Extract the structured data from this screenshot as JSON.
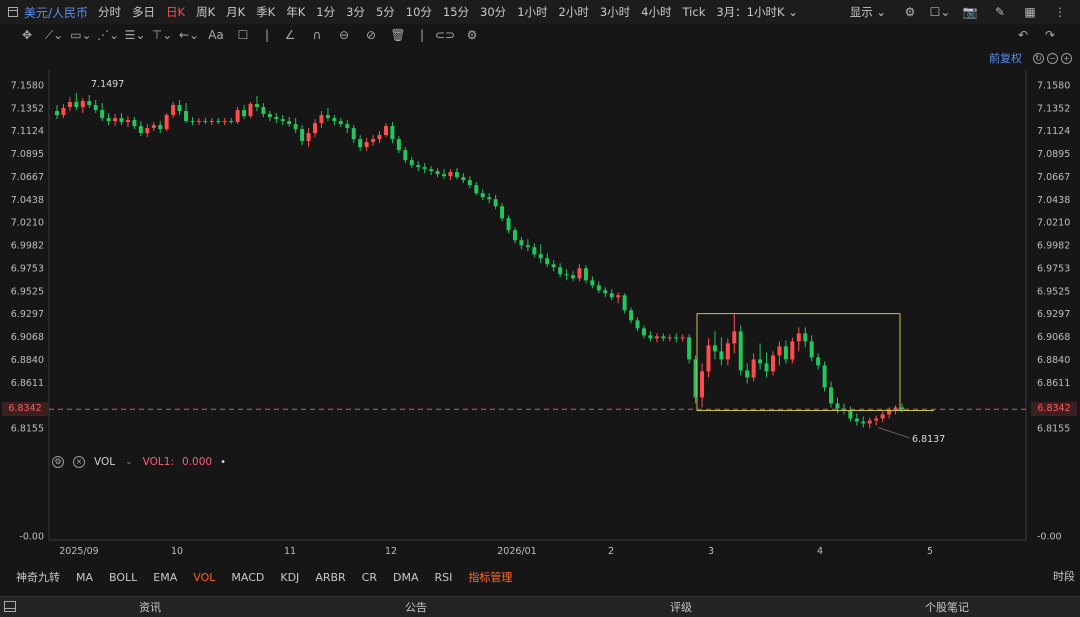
{
  "header": {
    "symbol": "美元/人民币",
    "periods": [
      "分时",
      "多日",
      "日K",
      "周K",
      "月K",
      "季K",
      "年K",
      "1分",
      "3分",
      "5分",
      "10分",
      "15分",
      "30分",
      "1小时",
      "2小时",
      "3小时",
      "4小时",
      "Tick"
    ],
    "active_period": "日K",
    "period_dropdown": "3月：1小时K",
    "display_label": "显示"
  },
  "toolbar": {
    "text_tool": "Aa",
    "adjust_label": "前复权"
  },
  "chart_data": {
    "type": "candlestick",
    "y_ticks": [
      "7.1580",
      "7.1352",
      "7.1124",
      "7.0895",
      "7.0667",
      "7.0438",
      "7.0210",
      "6.9982",
      "6.9753",
      "6.9525",
      "6.9297",
      "6.9068",
      "6.8840",
      "6.8611",
      "6.8382",
      "6.8155",
      "-0.00"
    ],
    "x_ticks": [
      "2025/09",
      "10",
      "11",
      "12",
      "2026/01",
      "2",
      "3",
      "4",
      "5"
    ],
    "ylim": [
      6.7927,
      7.158
    ],
    "current_price": "6.8342",
    "high_label": "7.1497",
    "low_label": "6.8137",
    "rect_top": 6.9297,
    "rect_bottom": 6.833,
    "up_color": "#ff4d4d",
    "down_color": "#22c55e",
    "candles": [
      [
        7.132,
        7.138,
        7.124,
        7.128
      ],
      [
        7.128,
        7.139,
        7.125,
        7.135
      ],
      [
        7.136,
        7.146,
        7.132,
        7.141
      ],
      [
        7.141,
        7.15,
        7.133,
        7.136
      ],
      [
        7.136,
        7.145,
        7.13,
        7.142
      ],
      [
        7.142,
        7.148,
        7.135,
        7.138
      ],
      [
        7.138,
        7.143,
        7.13,
        7.133
      ],
      [
        7.133,
        7.14,
        7.122,
        7.125
      ],
      [
        7.125,
        7.13,
        7.118,
        7.122
      ],
      [
        7.122,
        7.129,
        7.117,
        7.125
      ],
      [
        7.125,
        7.13,
        7.118,
        7.121
      ],
      [
        7.121,
        7.127,
        7.116,
        7.123
      ],
      [
        7.123,
        7.126,
        7.114,
        7.117
      ],
      [
        7.117,
        7.122,
        7.107,
        7.11
      ],
      [
        7.11,
        7.119,
        7.106,
        7.115
      ],
      [
        7.115,
        7.121,
        7.112,
        7.118
      ],
      [
        7.118,
        7.122,
        7.11,
        7.114
      ],
      [
        7.114,
        7.13,
        7.112,
        7.128
      ],
      [
        7.128,
        7.141,
        7.125,
        7.138
      ],
      [
        7.138,
        7.143,
        7.128,
        7.132
      ],
      [
        7.132,
        7.14,
        7.12,
        7.122
      ],
      [
        7.122,
        7.126,
        7.118,
        7.121
      ],
      [
        7.121,
        7.125,
        7.118,
        7.122
      ],
      [
        7.122,
        7.125,
        7.119,
        7.121
      ],
      [
        7.121,
        7.125,
        7.118,
        7.122
      ],
      [
        7.122,
        7.125,
        7.119,
        7.121
      ],
      [
        7.121,
        7.125,
        7.118,
        7.122
      ],
      [
        7.122,
        7.125,
        7.119,
        7.121
      ],
      [
        7.121,
        7.136,
        7.119,
        7.133
      ],
      [
        7.133,
        7.138,
        7.124,
        7.127
      ],
      [
        7.127,
        7.141,
        7.125,
        7.139
      ],
      [
        7.139,
        7.147,
        7.132,
        7.136
      ],
      [
        7.136,
        7.14,
        7.126,
        7.129
      ],
      [
        7.129,
        7.132,
        7.122,
        7.126
      ],
      [
        7.126,
        7.13,
        7.12,
        7.124
      ],
      [
        7.124,
        7.128,
        7.118,
        7.122
      ],
      [
        7.122,
        7.126,
        7.116,
        7.119
      ],
      [
        7.119,
        7.125,
        7.11,
        7.114
      ],
      [
        7.114,
        7.118,
        7.098,
        7.102
      ],
      [
        7.102,
        7.115,
        7.096,
        7.11
      ],
      [
        7.11,
        7.124,
        7.106,
        7.12
      ],
      [
        7.12,
        7.132,
        7.115,
        7.128
      ],
      [
        7.128,
        7.135,
        7.122,
        7.125
      ],
      [
        7.125,
        7.128,
        7.118,
        7.122
      ],
      [
        7.122,
        7.125,
        7.116,
        7.119
      ],
      [
        7.119,
        7.123,
        7.11,
        7.115
      ],
      [
        7.115,
        7.118,
        7.1,
        7.104
      ],
      [
        7.104,
        7.108,
        7.092,
        7.096
      ],
      [
        7.096,
        7.105,
        7.092,
        7.101
      ],
      [
        7.101,
        7.108,
        7.097,
        7.104
      ],
      [
        7.104,
        7.112,
        7.1,
        7.108
      ],
      [
        7.108,
        7.12,
        7.106,
        7.117
      ],
      [
        7.117,
        7.121,
        7.1,
        7.104
      ],
      [
        7.104,
        7.107,
        7.09,
        7.093
      ],
      [
        7.093,
        7.096,
        7.08,
        7.083
      ],
      [
        7.083,
        7.086,
        7.075,
        7.078
      ],
      [
        7.078,
        7.082,
        7.072,
        7.076
      ],
      [
        7.076,
        7.08,
        7.07,
        7.074
      ],
      [
        7.074,
        7.077,
        7.068,
        7.072
      ],
      [
        7.072,
        7.075,
        7.066,
        7.069
      ],
      [
        7.069,
        7.074,
        7.064,
        7.067
      ],
      [
        7.067,
        7.074,
        7.063,
        7.071
      ],
      [
        7.071,
        7.075,
        7.064,
        7.066
      ],
      [
        7.066,
        7.07,
        7.06,
        7.063
      ],
      [
        7.063,
        7.067,
        7.055,
        7.058
      ],
      [
        7.058,
        7.061,
        7.048,
        7.05
      ],
      [
        7.05,
        7.054,
        7.043,
        7.046
      ],
      [
        7.046,
        7.05,
        7.04,
        7.044
      ],
      [
        7.044,
        7.048,
        7.034,
        7.037
      ],
      [
        7.037,
        7.04,
        7.022,
        7.025
      ],
      [
        7.025,
        7.028,
        7.01,
        7.013
      ],
      [
        7.013,
        7.016,
        7.0,
        7.003
      ],
      [
        7.003,
        7.006,
        6.994,
        6.998
      ],
      [
        6.998,
        7.004,
        6.992,
        6.996
      ],
      [
        6.996,
        7.0,
        6.986,
        6.989
      ],
      [
        6.989,
        6.999,
        6.98,
        6.985
      ],
      [
        6.985,
        6.99,
        6.976,
        6.979
      ],
      [
        6.979,
        6.983,
        6.972,
        6.976
      ],
      [
        6.976,
        6.98,
        6.966,
        6.969
      ],
      [
        6.969,
        6.974,
        6.963,
        6.968
      ],
      [
        6.968,
        6.972,
        6.962,
        6.965
      ],
      [
        6.965,
        6.979,
        6.962,
        6.975
      ],
      [
        6.975,
        6.978,
        6.96,
        6.963
      ],
      [
        6.963,
        6.967,
        6.955,
        6.958
      ],
      [
        6.958,
        6.962,
        6.95,
        6.953
      ],
      [
        6.953,
        6.956,
        6.946,
        6.95
      ],
      [
        6.95,
        6.954,
        6.943,
        6.946
      ],
      [
        6.946,
        6.951,
        6.94,
        6.948
      ],
      [
        6.948,
        6.95,
        6.93,
        6.933
      ],
      [
        6.933,
        6.936,
        6.92,
        6.923
      ],
      [
        6.923,
        6.926,
        6.912,
        6.915
      ],
      [
        6.915,
        6.918,
        6.905,
        6.908
      ],
      [
        6.908,
        6.912,
        6.902,
        6.905
      ],
      [
        6.905,
        6.91,
        6.901,
        6.907
      ],
      [
        6.907,
        6.91,
        6.902,
        6.905
      ],
      [
        6.905,
        6.909,
        6.902,
        6.906
      ],
      [
        6.906,
        6.91,
        6.901,
        6.905
      ],
      [
        6.905,
        6.909,
        6.902,
        6.906
      ],
      [
        6.906,
        6.909,
        6.88,
        6.884
      ],
      [
        6.884,
        6.888,
        6.84,
        6.846
      ],
      [
        6.846,
        6.88,
        6.836,
        6.872
      ],
      [
        6.872,
        6.905,
        6.866,
        6.898
      ],
      [
        6.898,
        6.912,
        6.884,
        6.892
      ],
      [
        6.892,
        6.906,
        6.878,
        6.884
      ],
      [
        6.884,
        6.905,
        6.878,
        6.9
      ],
      [
        6.9,
        6.929,
        6.89,
        6.912
      ],
      [
        6.912,
        6.918,
        6.868,
        6.873
      ],
      [
        6.873,
        6.88,
        6.86,
        6.866
      ],
      [
        6.866,
        6.89,
        6.862,
        6.884
      ],
      [
        6.884,
        6.9,
        6.874,
        6.88
      ],
      [
        6.88,
        6.891,
        6.866,
        6.872
      ],
      [
        6.872,
        6.892,
        6.868,
        6.888
      ],
      [
        6.888,
        6.902,
        6.878,
        6.897
      ],
      [
        6.897,
        6.903,
        6.88,
        6.884
      ],
      [
        6.884,
        6.906,
        6.88,
        6.902
      ],
      [
        6.902,
        6.916,
        6.892,
        6.91
      ],
      [
        6.91,
        6.916,
        6.896,
        6.902
      ],
      [
        6.902,
        6.908,
        6.882,
        6.886
      ],
      [
        6.886,
        6.89,
        6.874,
        6.878
      ],
      [
        6.878,
        6.882,
        6.852,
        6.856
      ],
      [
        6.856,
        6.862,
        6.836,
        6.84
      ],
      [
        6.84,
        6.846,
        6.83,
        6.835
      ],
      [
        6.835,
        6.84,
        6.829,
        6.833
      ],
      [
        6.833,
        6.837,
        6.822,
        6.825
      ],
      [
        6.825,
        6.83,
        6.818,
        6.822
      ],
      [
        6.822,
        6.827,
        6.816,
        6.82
      ],
      [
        6.82,
        6.826,
        6.815,
        6.823
      ],
      [
        6.823,
        6.828,
        6.818,
        6.825
      ],
      [
        6.825,
        6.832,
        6.821,
        6.829
      ],
      [
        6.829,
        6.836,
        6.825,
        6.833
      ],
      [
        6.833,
        6.838,
        6.829,
        6.836
      ],
      [
        6.836,
        6.84,
        6.831,
        6.834
      ]
    ]
  },
  "vol": {
    "name": "VOL",
    "key": "VOL1:",
    "value": "0.000",
    "dot": "•"
  },
  "indicators": [
    "神奇九转",
    "MA",
    "BOLL",
    "EMA",
    "VOL",
    "MACD",
    "KDJ",
    "ARBR",
    "CR",
    "DMA",
    "RSI",
    "指标管理"
  ],
  "active_indicator": "VOL",
  "time_tab": "时段",
  "bottom_tabs": [
    "资讯",
    "公告",
    "评级",
    "个股笔记"
  ]
}
